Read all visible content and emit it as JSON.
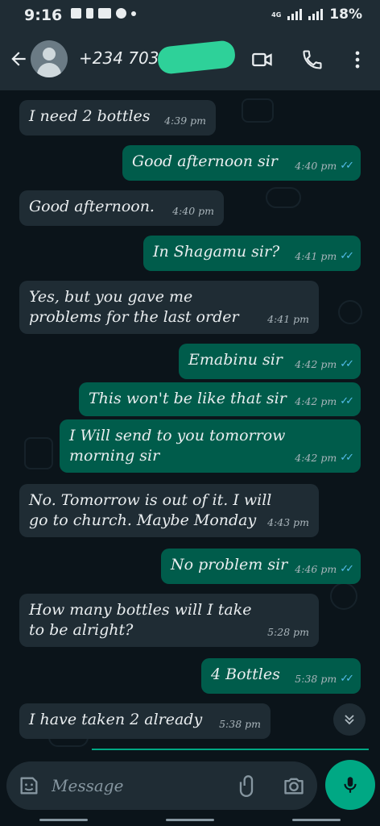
{
  "status_bar": {
    "time": "9:16",
    "network": "4G",
    "battery": "18%"
  },
  "header": {
    "contact_name": "+234 703 33..."
  },
  "messages": [
    {
      "dir": "in",
      "text": "I need 2 bottles",
      "time": "4:39 pm"
    },
    {
      "dir": "out",
      "text": "Good afternoon sir",
      "time": "4:40 pm"
    },
    {
      "dir": "in",
      "text": "Good afternoon.",
      "time": "4:40 pm"
    },
    {
      "dir": "out",
      "text": "In Shagamu sir?",
      "time": "4:41 pm"
    },
    {
      "dir": "in",
      "text": "Yes, but you gave me problems for the last order",
      "time": "4:41 pm"
    },
    {
      "dir": "out",
      "text": "Emabinu sir",
      "time": "4:42 pm"
    },
    {
      "dir": "out",
      "text": "This won't be like that sir",
      "time": "4:42 pm"
    },
    {
      "dir": "out",
      "text": "I Will send to you tomorrow morning sir",
      "time": "4:42 pm"
    },
    {
      "dir": "in",
      "text": "No. Tomorrow is out of it. I will go to church. Maybe Monday",
      "time": "4:43 pm"
    },
    {
      "dir": "out",
      "text": "No problem sir",
      "time": "4:46 pm"
    },
    {
      "dir": "in",
      "text": "How many bottles will I take to be alright?",
      "time": "5:28 pm"
    },
    {
      "dir": "out",
      "text": "4 Bottles",
      "time": "5:38 pm"
    },
    {
      "dir": "in",
      "text": "I have taken 2 already",
      "time": "5:38 pm"
    }
  ],
  "composer": {
    "placeholder": "Message"
  },
  "colors": {
    "incoming": "#1f2c34",
    "outgoing": "#005c4b",
    "accent": "#00a884",
    "read_ticks": "#53bdeb"
  }
}
